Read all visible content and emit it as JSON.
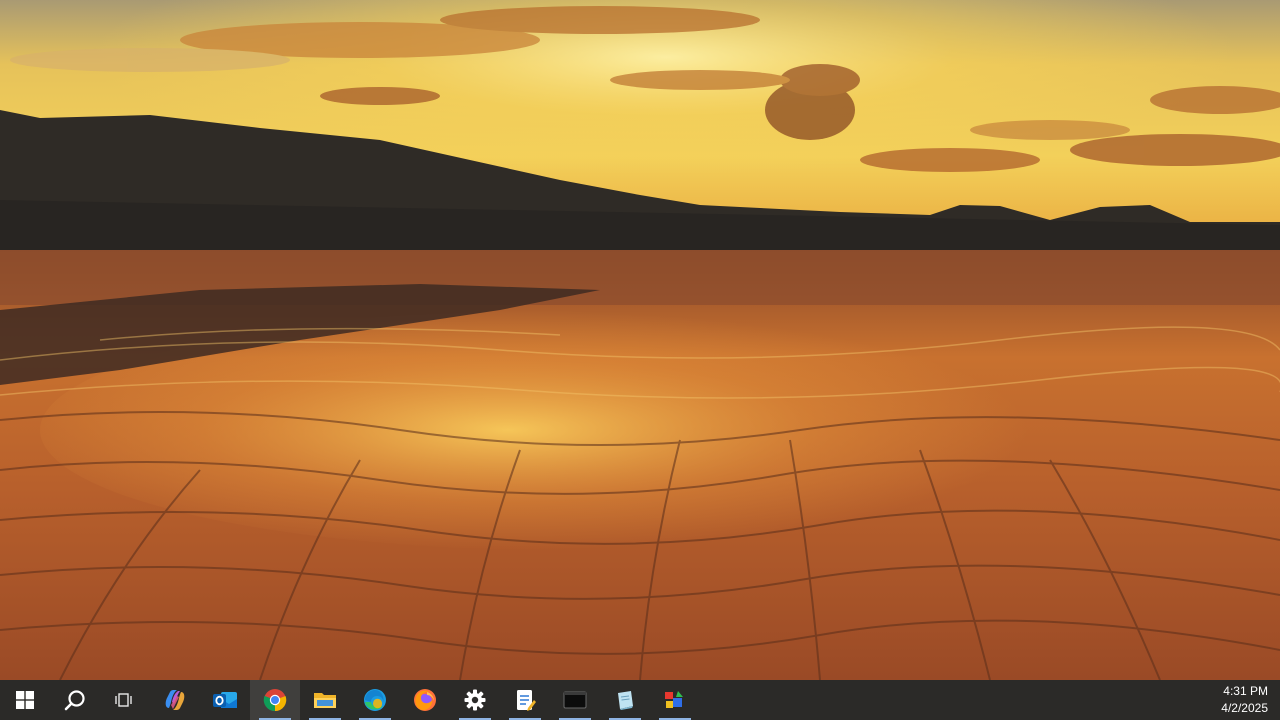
{
  "desktop": {
    "wallpaper": "sunset-over-geothermal-terraces-landscape",
    "colors": {
      "sky_top": "#c9b27a",
      "sky_glow": "#f5c842",
      "mountain": "#2e2a25",
      "ground": "#a8552a"
    }
  },
  "taskbar": {
    "background": "#2b2a28",
    "indicator_color": "#8fb4e3",
    "items": [
      {
        "icon": "windows-start-icon",
        "running": false,
        "active": false
      },
      {
        "icon": "search-icon",
        "running": false,
        "active": false
      },
      {
        "icon": "task-view-icon",
        "running": false,
        "active": false
      },
      {
        "icon": "copilot-icon",
        "running": false,
        "active": false
      },
      {
        "icon": "outlook-icon",
        "running": false,
        "active": false
      },
      {
        "icon": "chrome-icon",
        "running": true,
        "active": true
      },
      {
        "icon": "file-explorer-icon",
        "running": true,
        "active": false
      },
      {
        "icon": "edge-icon",
        "running": true,
        "active": false
      },
      {
        "icon": "firefox-icon",
        "running": false,
        "active": false
      },
      {
        "icon": "settings-icon",
        "running": true,
        "active": false
      },
      {
        "icon": "notepad-icon",
        "running": true,
        "active": false
      },
      {
        "icon": "terminal-icon",
        "running": true,
        "active": false
      },
      {
        "icon": "notes-icon",
        "running": true,
        "active": false
      },
      {
        "icon": "paint-icon",
        "running": true,
        "active": false
      }
    ]
  },
  "clock": {
    "time": "4:31 PM",
    "date": "4/2/2025"
  }
}
